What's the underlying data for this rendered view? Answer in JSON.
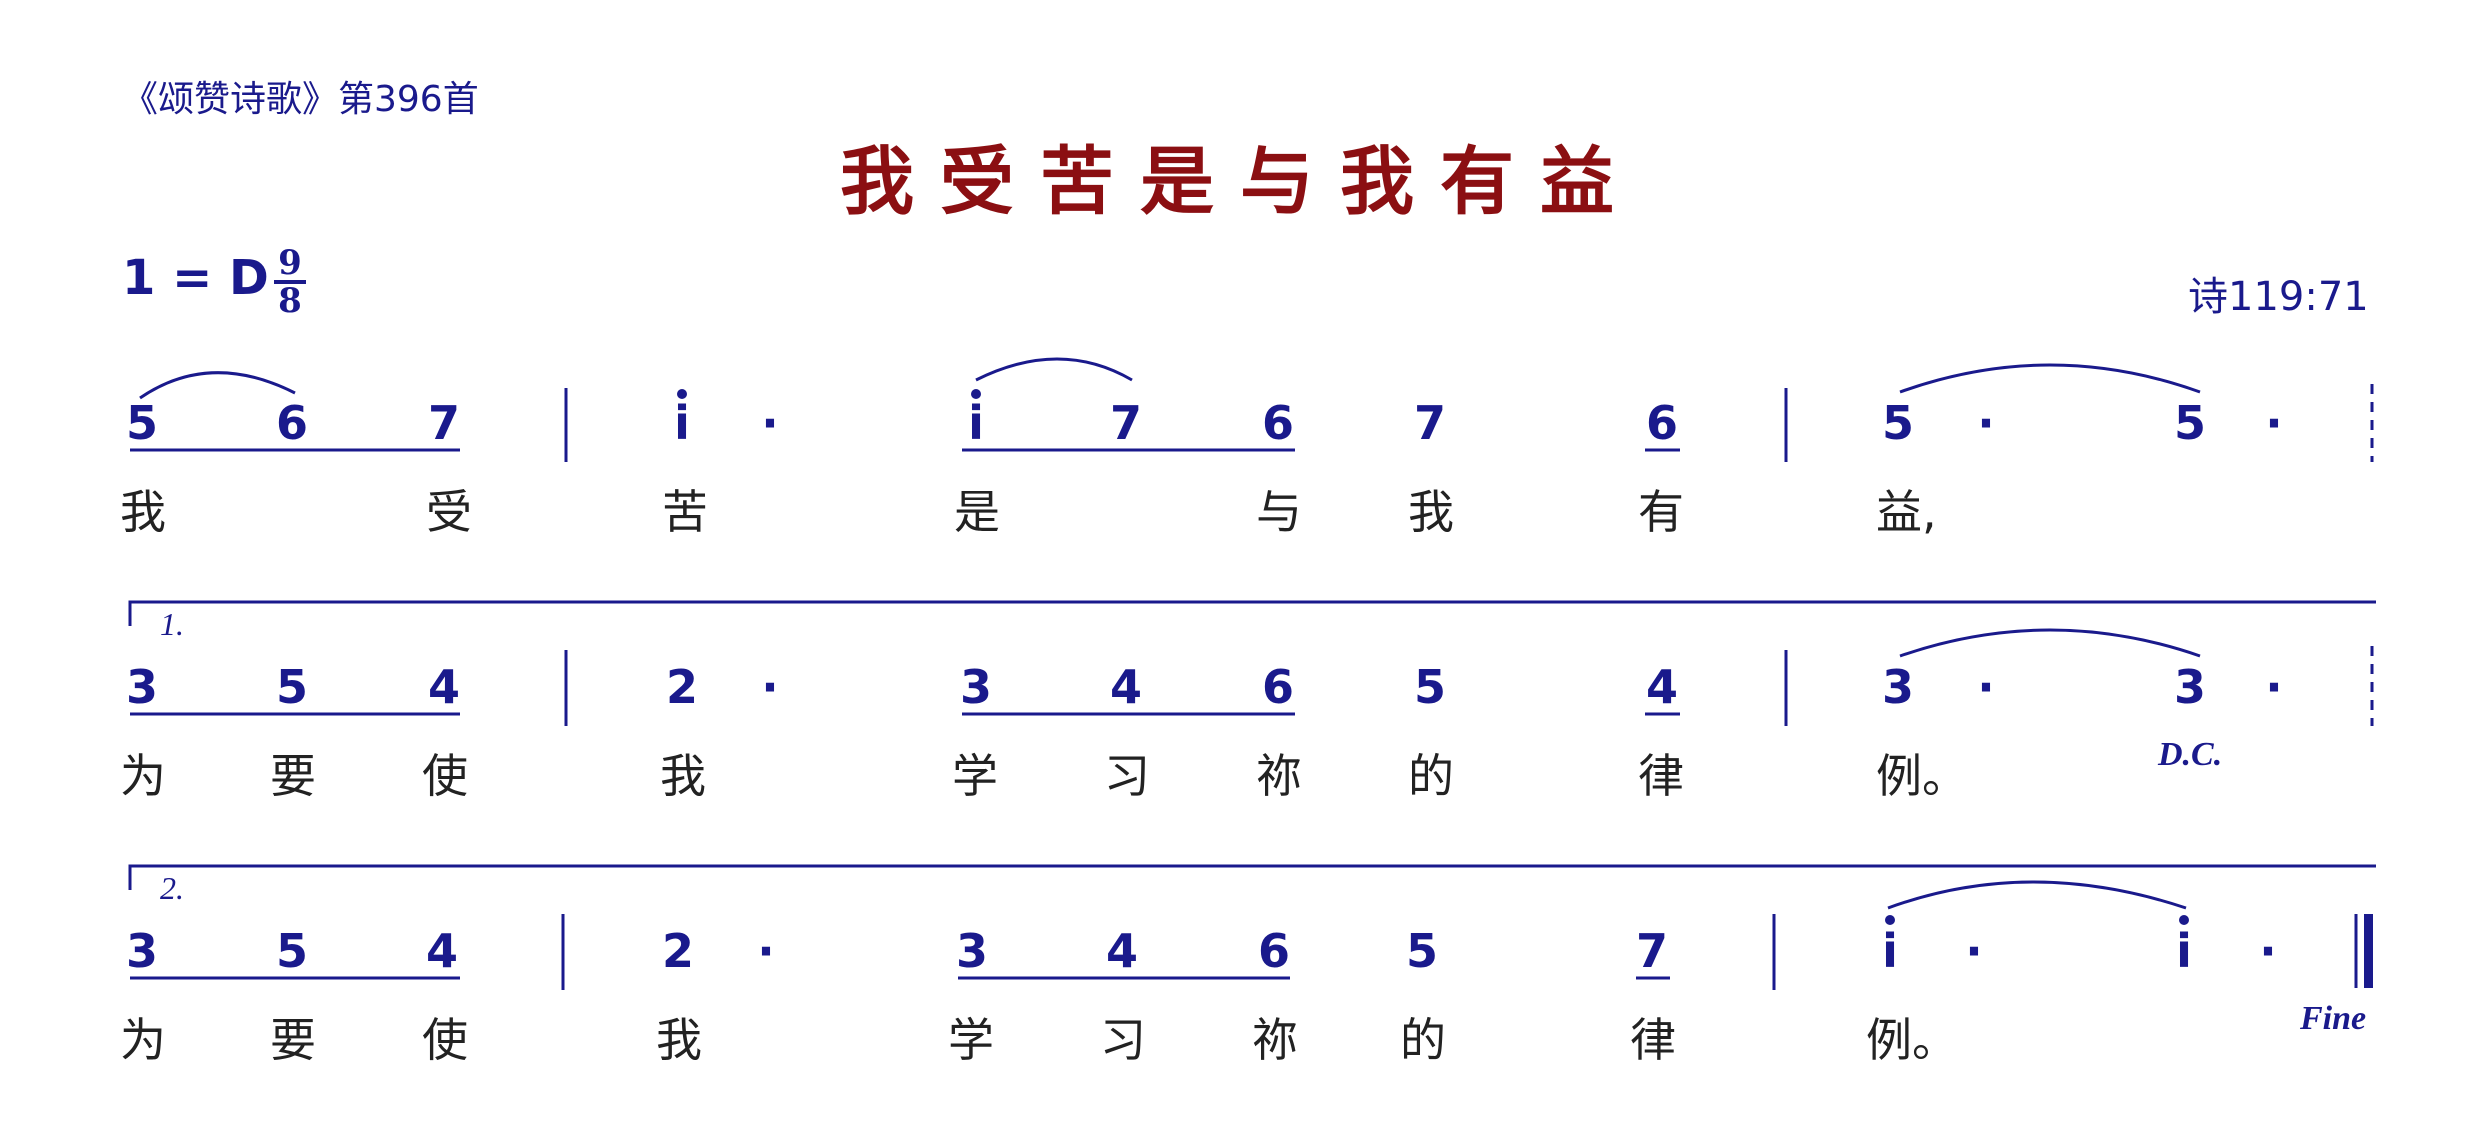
{
  "header": {
    "source": "《颂赞诗歌》第396首",
    "title": "我受苦是与我有益",
    "key": "1 = D",
    "time_top": "9",
    "time_bottom": "8",
    "reference": "诗119:71"
  },
  "rows": [
    {
      "notes": [
        "5",
        "6",
        "7",
        "i",
        "·",
        "i",
        "7",
        "6",
        "7",
        "6",
        "5",
        "·",
        "5",
        "·"
      ],
      "lyrics": [
        "我",
        "受",
        "苦",
        "是",
        "与",
        "我",
        "有",
        "益,"
      ],
      "marker": ""
    },
    {
      "volta": "1.",
      "notes": [
        "3",
        "5",
        "4",
        "2",
        "·",
        "3",
        "4",
        "6",
        "5",
        "4",
        "3",
        "·",
        "3",
        "·"
      ],
      "lyrics": [
        "为",
        "要",
        "使",
        "我",
        "学",
        "习",
        "祢",
        "的",
        "律",
        "例。"
      ],
      "marker": "D.C."
    },
    {
      "volta": "2.",
      "notes": [
        "3",
        "5",
        "4",
        "2",
        "·",
        "3",
        "4",
        "6",
        "5",
        "7",
        "i",
        "·",
        "i",
        "·"
      ],
      "lyrics": [
        "为",
        "要",
        "使",
        "我",
        "学",
        "习",
        "祢",
        "的",
        "律",
        "例。"
      ],
      "marker": "Fine"
    }
  ]
}
